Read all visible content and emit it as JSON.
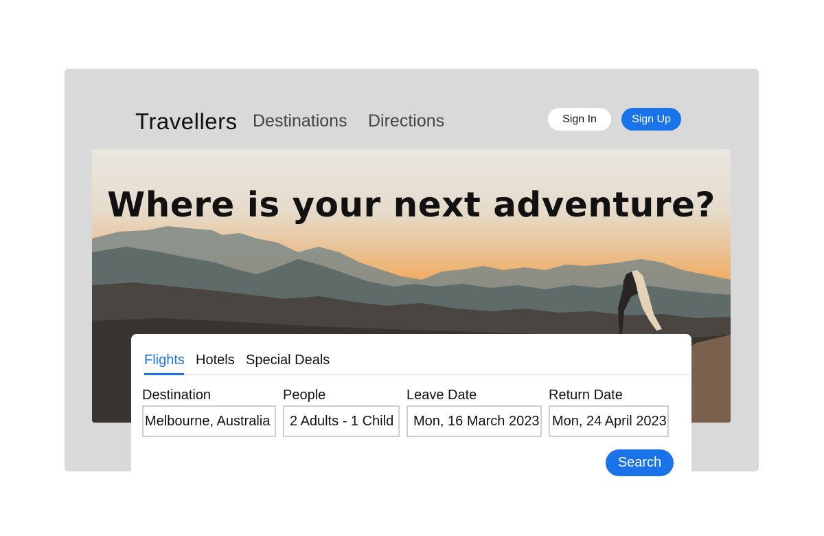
{
  "nav": {
    "brand": "Travellers",
    "links": [
      "Destinations",
      "Directions"
    ],
    "sign_in": "Sign In",
    "sign_up": "Sign Up"
  },
  "hero": {
    "headline": "Where is your next adventure?"
  },
  "search_card": {
    "tabs": [
      "Flights",
      "Hotels",
      "Special Deals"
    ],
    "active_tab": "Flights",
    "fields": {
      "destination": {
        "label": "Destination",
        "value": "Melbourne, Australia"
      },
      "people": {
        "label": "People",
        "value": "2 Adults - 1 Child"
      },
      "leave_date": {
        "label": "Leave Date",
        "value": "Mon, 16 March 2023"
      },
      "return_date": {
        "label": "Return Date",
        "value": "Mon, 24 April 2023"
      }
    },
    "search_label": "Search"
  },
  "colors": {
    "accent": "#1a73e8",
    "frame": "#d9d9d9",
    "text": "#111111"
  }
}
